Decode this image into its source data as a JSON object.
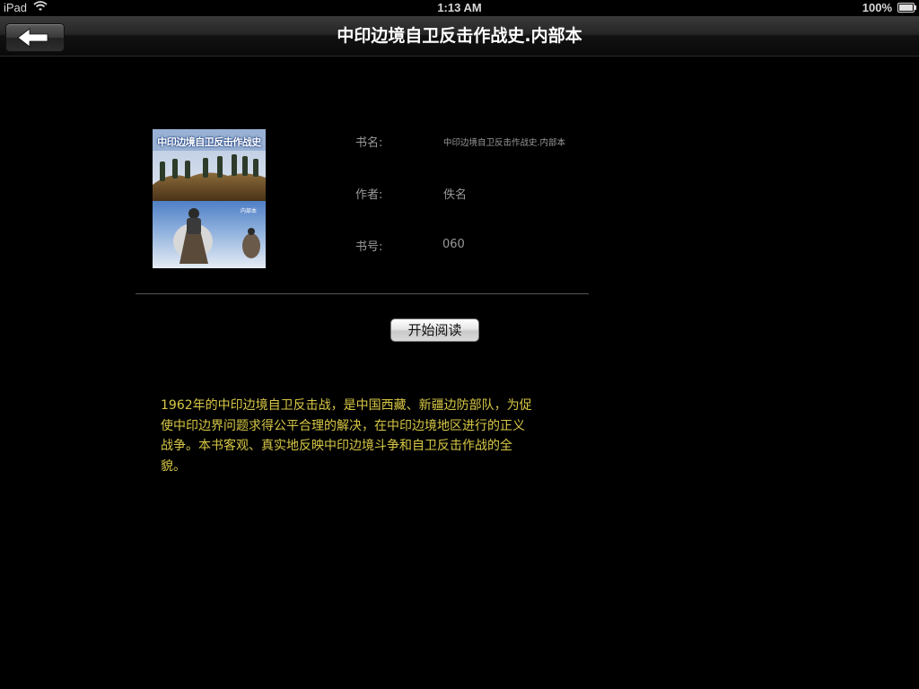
{
  "status_bar": {
    "device": "iPad",
    "time": "1:13 AM",
    "battery": "100%"
  },
  "nav_bar": {
    "title": "中印边境自卫反击作战史.内部本"
  },
  "book": {
    "cover_title": "中印边境自卫反击作战史",
    "cover_subtitle": "内部本",
    "fields": [
      {
        "label": "书名:",
        "value": "中印边境自卫反击作战史.内部本"
      },
      {
        "label": "作者:",
        "value": "佚名"
      },
      {
        "label": "书号:",
        "value": "060"
      }
    ]
  },
  "actions": {
    "start_reading": "开始阅读"
  },
  "description": "1962年的中印边境自卫反击战，是中国西藏、新疆边防部队，为促\n使中印边界问题求得公平合理的解决，在中印边境地区进行的正义\n战争。本书客观、真实地反映中印边境斗争和自卫反击作战的全\n貌。",
  "colors": {
    "background": "#000000",
    "label": "#9a9a9a",
    "description": "#d8c845"
  }
}
